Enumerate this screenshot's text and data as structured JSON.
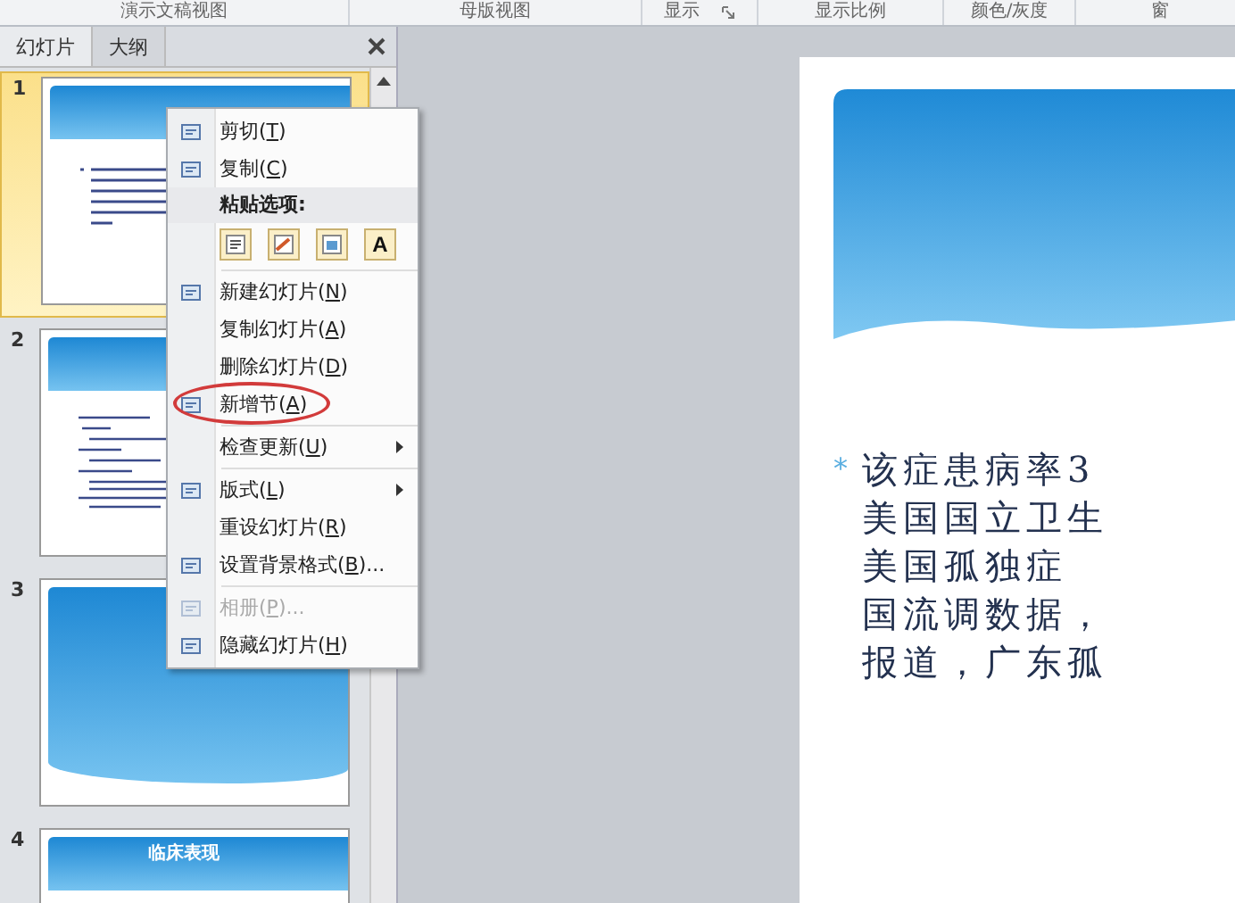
{
  "ribbon_groups": [
    "演示文稿视图",
    "母版视图",
    "显示",
    "显示比例",
    "颜色/灰度",
    "窗"
  ],
  "panel_tabs": [
    {
      "label": "幻灯片",
      "selected": true
    },
    {
      "label": "大纲",
      "selected": false
    }
  ],
  "slides": [
    {
      "number": "1",
      "selected": true,
      "kind": "text"
    },
    {
      "number": "2",
      "selected": false,
      "kind": "list"
    },
    {
      "number": "3",
      "selected": false,
      "kind": "blank"
    },
    {
      "number": "4",
      "selected": false,
      "kind": "title",
      "title": "临床表现"
    }
  ],
  "context_menu": [
    {
      "kind": "item",
      "before": "剪切(",
      "key": "T",
      "after": ")",
      "disabled": false,
      "submenu": false,
      "highlighted": false
    },
    {
      "kind": "item",
      "before": "复制(",
      "key": "C",
      "after": ")",
      "disabled": false,
      "submenu": false,
      "highlighted": false
    },
    {
      "kind": "header",
      "label": "粘贴选项:"
    },
    {
      "kind": "paste",
      "options": [
        {
          "kind": "theme"
        },
        {
          "kind": "format"
        },
        {
          "kind": "picture"
        },
        {
          "kind": "text",
          "label": "A"
        }
      ]
    },
    {
      "kind": "separator"
    },
    {
      "kind": "item",
      "before": "新建幻灯片(",
      "key": "N",
      "after": ")",
      "disabled": false,
      "submenu": false,
      "highlighted": false
    },
    {
      "kind": "item",
      "before": "复制幻灯片(",
      "key": "A",
      "after": ")",
      "disabled": false,
      "submenu": false,
      "highlighted": false
    },
    {
      "kind": "item",
      "before": "删除幻灯片(",
      "key": "D",
      "after": ")",
      "disabled": false,
      "submenu": false,
      "highlighted": false
    },
    {
      "kind": "item",
      "before": "新增节(",
      "key": "A",
      "after": ")",
      "disabled": false,
      "submenu": false,
      "highlighted": true
    },
    {
      "kind": "separator"
    },
    {
      "kind": "item",
      "before": "检查更新(",
      "key": "U",
      "after": ")",
      "disabled": false,
      "submenu": true,
      "highlighted": false
    },
    {
      "kind": "separator"
    },
    {
      "kind": "item",
      "before": "版式(",
      "key": "L",
      "after": ")",
      "disabled": false,
      "submenu": true,
      "highlighted": false
    },
    {
      "kind": "item",
      "before": "重设幻灯片(",
      "key": "R",
      "after": ")",
      "disabled": false,
      "submenu": false,
      "highlighted": false
    },
    {
      "kind": "item",
      "before": "设置背景格式(",
      "key": "B",
      "after": ")...",
      "disabled": false,
      "submenu": false,
      "highlighted": false
    },
    {
      "kind": "separator"
    },
    {
      "kind": "item",
      "before": "相册(",
      "key": "P",
      "after": ")...",
      "disabled": true,
      "submenu": false,
      "highlighted": false
    },
    {
      "kind": "item",
      "before": "隐藏幻灯片(",
      "key": "H",
      "after": ")",
      "disabled": false,
      "submenu": false,
      "highlighted": false
    }
  ],
  "slide_body": {
    "bullet": "*",
    "lines": [
      "该症患病率3",
      "美国国立卫生",
      "美国孤独症",
      "国流调数据，",
      "报道，广东孤"
    ]
  }
}
